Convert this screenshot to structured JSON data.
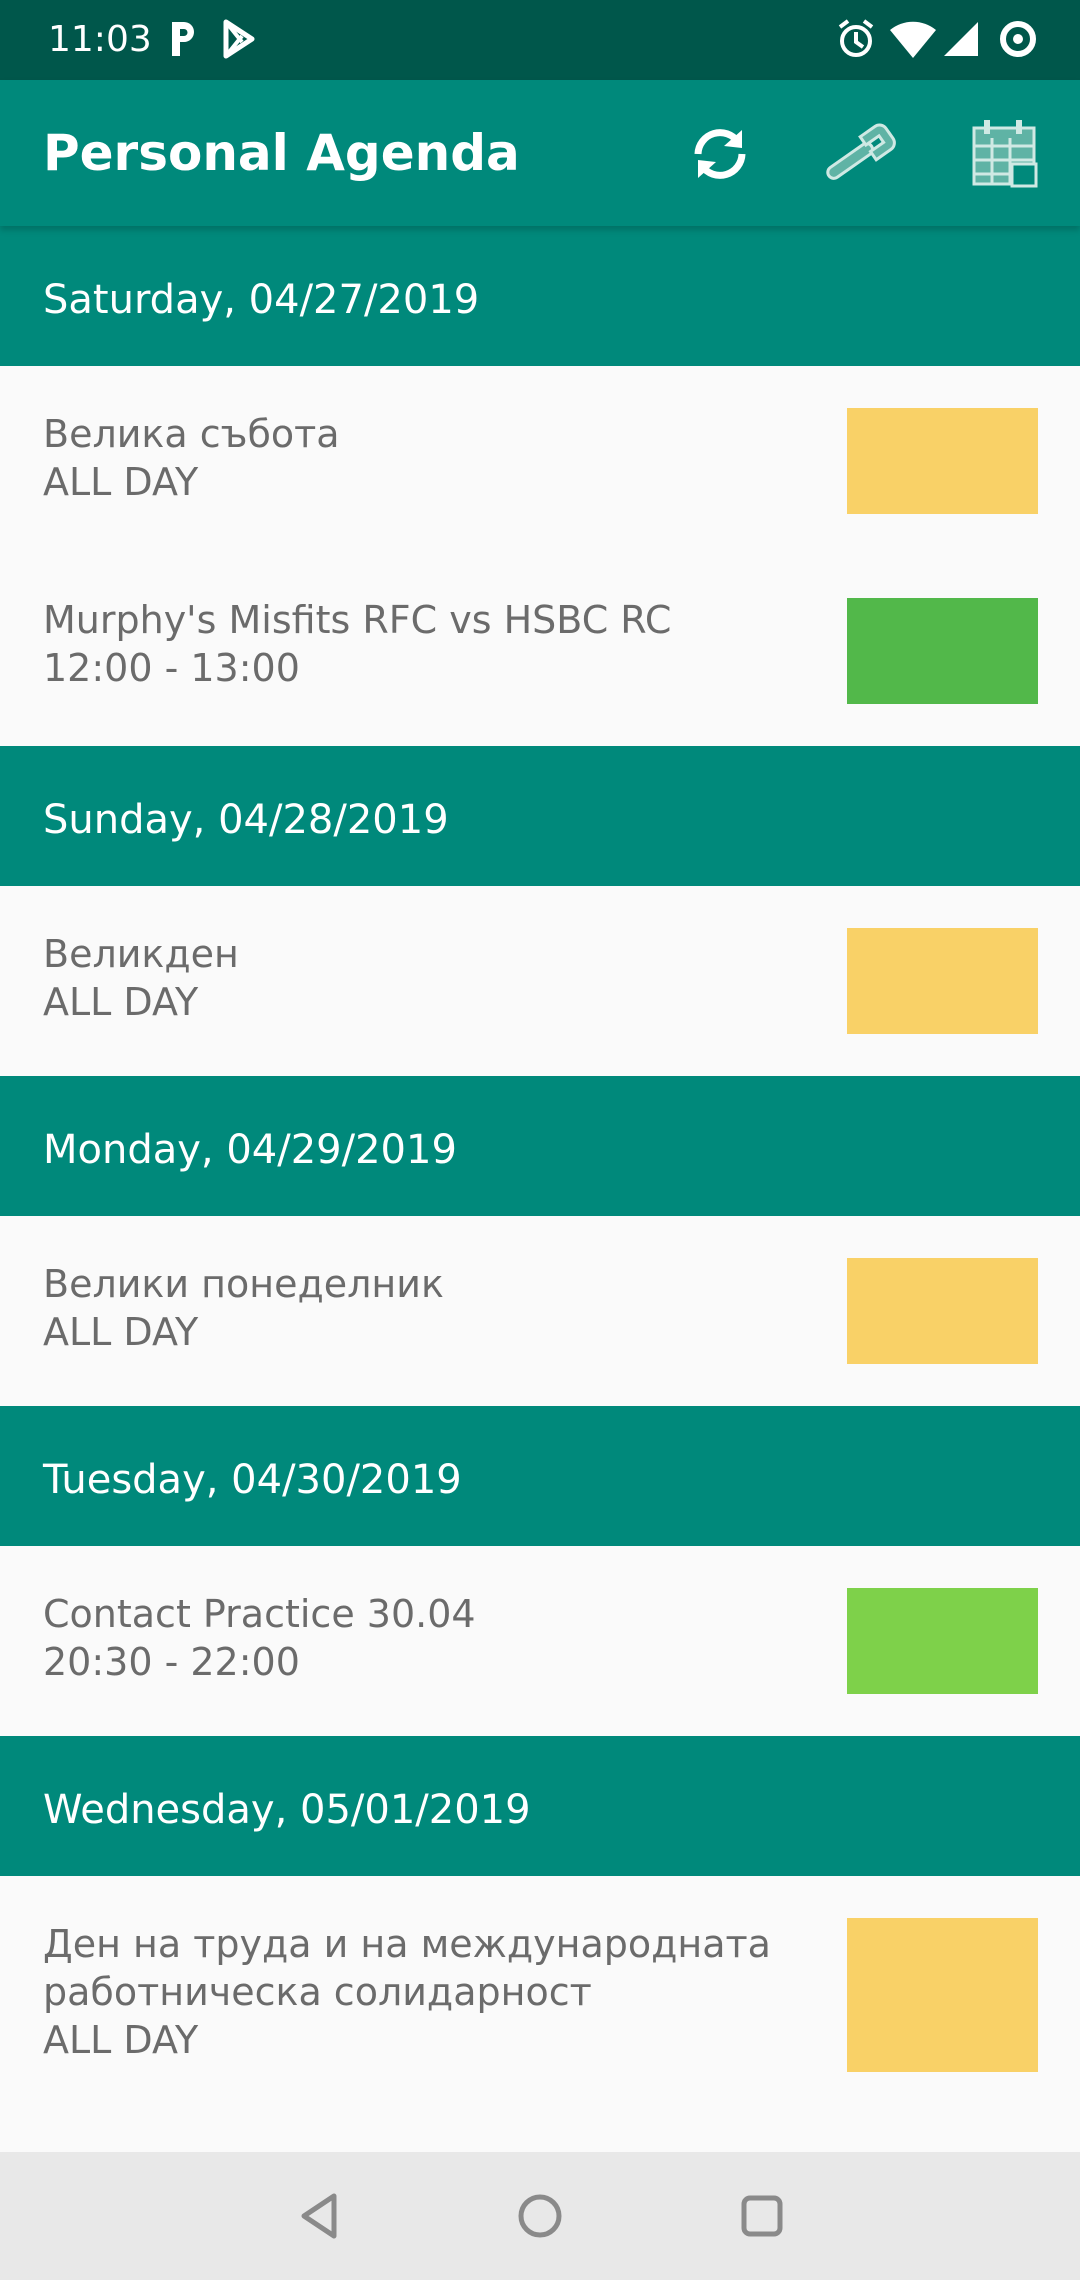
{
  "status_bar": {
    "time": "11:03",
    "left_icons": [
      "parking-notification-icon",
      "play-store-notification-icon"
    ],
    "right_icons": [
      "alarm-icon",
      "wifi-icon",
      "cell-signal-icon",
      "data-saver-icon"
    ]
  },
  "app_bar": {
    "title": "Personal Agenda",
    "actions": [
      "sync-icon",
      "wrench-icon",
      "calendar-grid-icon"
    ]
  },
  "colors": {
    "primary": "#00897b",
    "primary_dark": "#00574b",
    "holiday": "#f9d167",
    "rugby_match": "#52b84a",
    "practice": "#7ed14a"
  },
  "agenda": [
    {
      "date": "Saturday, 04/27/2019",
      "events": [
        {
          "title": "Велика събота",
          "time": "ALL DAY",
          "color": "#f9d167"
        },
        {
          "title": "Murphy's Misfits RFC vs HSBC RC",
          "time": "12:00 - 13:00",
          "color": "#52b84a"
        }
      ]
    },
    {
      "date": "Sunday, 04/28/2019",
      "events": [
        {
          "title": "Великден",
          "time": "ALL DAY",
          "color": "#f9d167"
        }
      ]
    },
    {
      "date": "Monday, 04/29/2019",
      "events": [
        {
          "title": "Велики понеделник",
          "time": "ALL DAY",
          "color": "#f9d167"
        }
      ]
    },
    {
      "date": "Tuesday, 04/30/2019",
      "events": [
        {
          "title": "Contact Practice 30.04",
          "time": "20:30 - 22:00",
          "color": "#7ed14a"
        }
      ]
    },
    {
      "date": "Wednesday, 05/01/2019",
      "events": [
        {
          "title_lines": [
            "Ден на труда и на международната",
            "работническа солидарност"
          ],
          "time": "ALL DAY",
          "color": "#f9d167"
        }
      ]
    }
  ],
  "nav_bar": {
    "buttons": [
      "back-icon",
      "home-icon",
      "recents-icon"
    ]
  }
}
